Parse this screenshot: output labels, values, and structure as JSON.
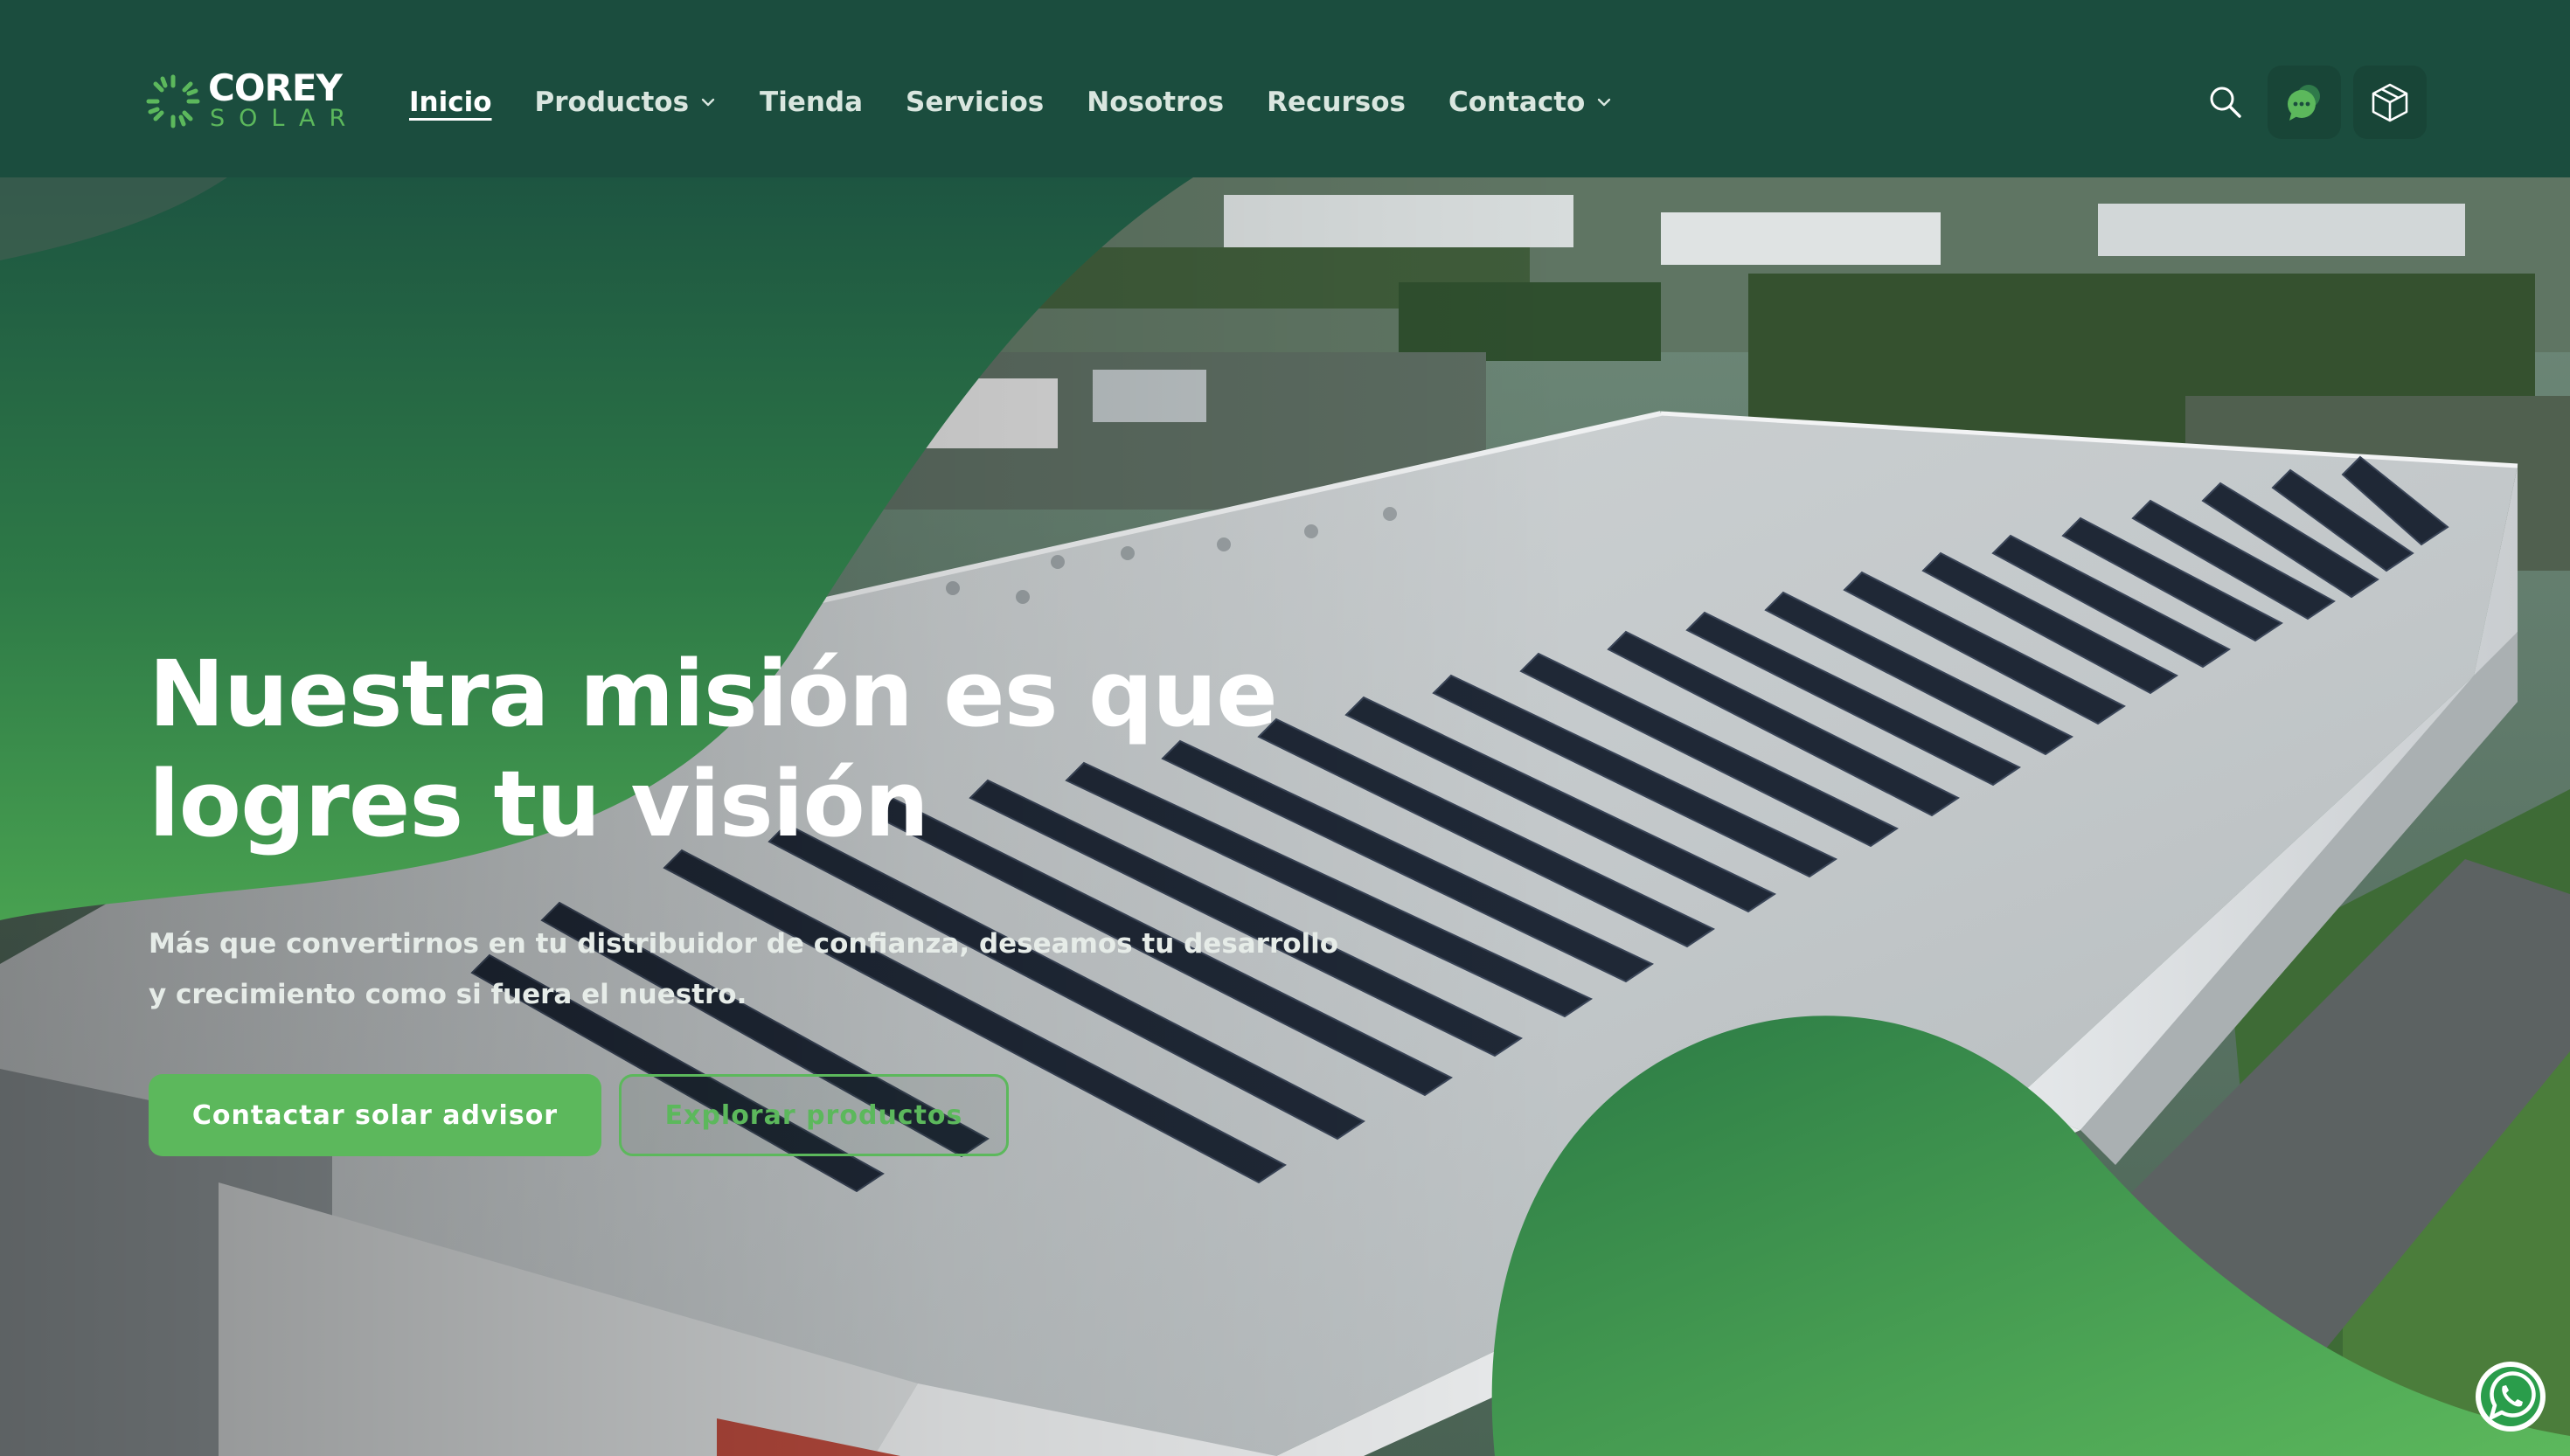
{
  "brand": {
    "name_line1": "COREY",
    "name_line2": "SOLAR",
    "primary_color": "#1b4d3e",
    "accent_color": "#5cb85c"
  },
  "nav": {
    "items": [
      {
        "label": "Inicio",
        "active": true,
        "has_dropdown": false
      },
      {
        "label": "Productos",
        "active": false,
        "has_dropdown": true
      },
      {
        "label": "Tienda",
        "active": false,
        "has_dropdown": false
      },
      {
        "label": "Servicios",
        "active": false,
        "has_dropdown": false
      },
      {
        "label": "Nosotros",
        "active": false,
        "has_dropdown": false
      },
      {
        "label": "Recursos",
        "active": false,
        "has_dropdown": false
      },
      {
        "label": "Contacto",
        "active": false,
        "has_dropdown": true
      }
    ]
  },
  "header_icons": [
    "search-icon",
    "chat-icon",
    "box-icon"
  ],
  "hero": {
    "title_line1": "Nuestra misión es que",
    "title_line2": "logres tu visión",
    "subtitle_line1": "Más que convertirnos en tu distribuidor de confianza, deseamos tu desarrollo",
    "subtitle_line2": "y crecimiento como si fuera el nuestro.",
    "primary_button": "Contactar solar advisor",
    "secondary_button": "Explorar productos"
  },
  "floating": {
    "whatsapp_icon": "whatsapp-icon"
  }
}
